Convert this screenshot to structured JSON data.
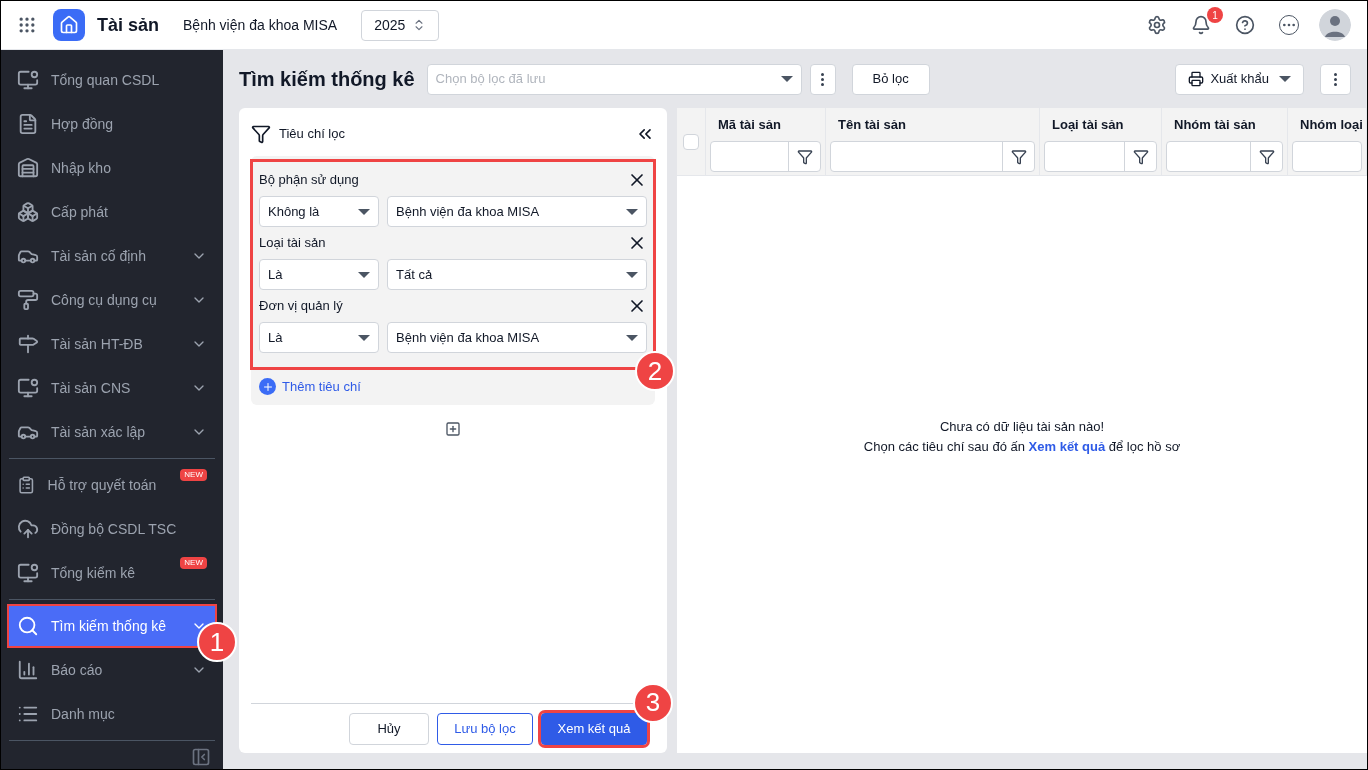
{
  "topbar": {
    "app_name": "Tài sản",
    "org": "Bệnh viện đa khoa MISA",
    "year": "2025",
    "notifications": "1"
  },
  "sidebar": {
    "groups": [
      [
        {
          "label": "Tổng quan CSDL",
          "expandable": false,
          "selected": false
        },
        {
          "label": "Hợp đồng",
          "expandable": false,
          "selected": false
        },
        {
          "label": "Nhập kho",
          "expandable": false,
          "selected": false
        },
        {
          "label": "Cấp phát",
          "expandable": false,
          "selected": false
        },
        {
          "label": "Tài sản cố định",
          "expandable": true,
          "selected": false
        },
        {
          "label": "Công cụ dụng cụ",
          "expandable": true,
          "selected": false
        },
        {
          "label": "Tài sản HT-ĐB",
          "expandable": true,
          "selected": false
        },
        {
          "label": "Tài sản CNS",
          "expandable": true,
          "selected": false
        },
        {
          "label": "Tài sản xác lập",
          "expandable": true,
          "selected": false
        }
      ],
      [
        {
          "label": "Hỗ trợ quyết toán",
          "expandable": false,
          "selected": false,
          "badge": "NEW"
        },
        {
          "label": "Đồng bộ CSDL TSC",
          "expandable": false,
          "selected": false
        },
        {
          "label": "Tổng kiểm kê",
          "expandable": false,
          "selected": false,
          "badge": "NEW"
        }
      ],
      [
        {
          "label": "Tìm kiếm thống kê",
          "expandable": true,
          "selected": true,
          "callout": "1"
        },
        {
          "label": "Báo cáo",
          "expandable": true,
          "selected": false
        },
        {
          "label": "Danh mục",
          "expandable": false,
          "selected": false
        }
      ]
    ]
  },
  "page": {
    "title": "Tìm kiếm thống kê",
    "saved_filter_placeholder": "Chọn bộ lọc đã lưu",
    "clear_button": "Bỏ lọc",
    "export_button": "Xuất khẩu"
  },
  "filter_panel": {
    "title": "Tiêu chí lọc",
    "callout": "2",
    "criteria": [
      {
        "label": "Bộ phận sử dụng",
        "operator": "Không là",
        "value": "Bệnh viện đa khoa MISA"
      },
      {
        "label": "Loại tài sản",
        "operator": "Là",
        "value": "Tất cả"
      },
      {
        "label": "Đơn vị quản lý",
        "operator": "Là",
        "value": "Bệnh viện đa khoa MISA"
      }
    ],
    "add_criterion": "Thêm tiêu chí",
    "buttons": {
      "cancel": "Hủy",
      "save": "Lưu bộ lọc",
      "apply": "Xem kết quả",
      "apply_callout": "3"
    }
  },
  "table": {
    "select_all": false,
    "columns": [
      "Mã tài sản",
      "Tên tài sản",
      "Loại tài sản",
      "Nhóm tài sản",
      "Nhóm loại"
    ],
    "empty_title": "Chưa có dữ liệu tài sản nào!",
    "empty_hint": "Chọn các tiêu chí sau đó ấn **Xem kết quả** để lọc hồ sơ"
  }
}
